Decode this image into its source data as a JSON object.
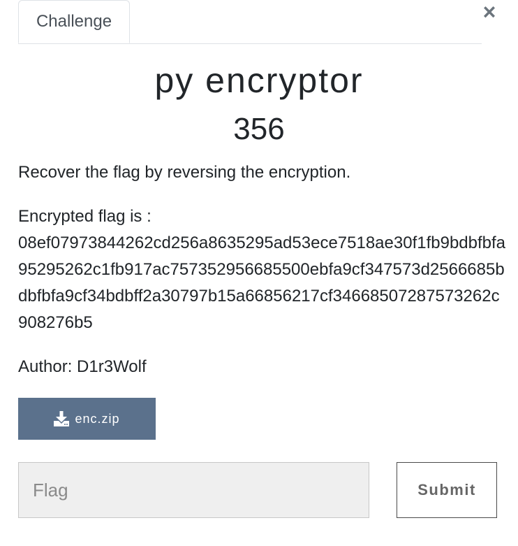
{
  "tab": {
    "label": "Challenge"
  },
  "close": {
    "glyph": "×"
  },
  "challenge": {
    "name": "py encryptor",
    "points": "356",
    "description": "Recover the flag by reversing the encryption.",
    "encrypted_label": "Encrypted flag is :",
    "encrypted_hex": "08ef07973844262cd256a8635295ad53ece7518ae30f1fb9bdbfbfa95295262c1fb917ac757352956685500ebfa9cf347573d2566685bdbfbfa9cf34bdbff2a30797b15a66856217cf34668507287573262c908276b5",
    "author": "Author: D1r3Wolf"
  },
  "download": {
    "label": "enc.zip",
    "icon": "download-icon"
  },
  "form": {
    "flag_placeholder": "Flag",
    "flag_value": "",
    "submit_label": "Submit"
  },
  "colors": {
    "download_button": "#5b718c",
    "input_background": "#efefef",
    "text": "#212529"
  }
}
